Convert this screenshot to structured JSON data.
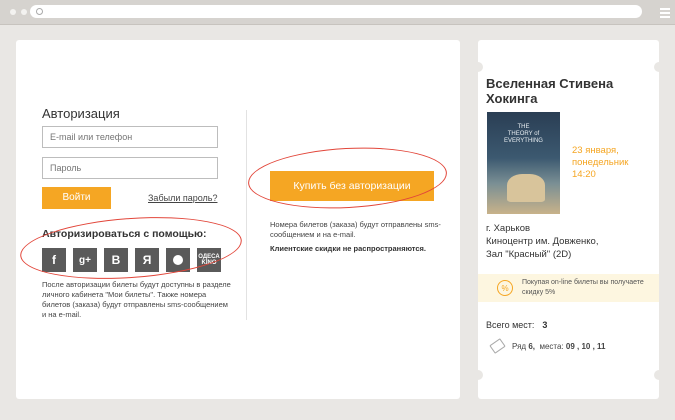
{
  "browser": {
    "icon": "search-icon"
  },
  "auth": {
    "title": "Авторизация",
    "email_placeholder": "E-mail или телефон",
    "password_placeholder": "Пароль",
    "login_label": "Войти",
    "forgot_label": "Забыли пароль?",
    "social_title": "Авторизироваться с помощью:",
    "social": {
      "facebook": "f",
      "gplus": "g+",
      "vk": "B",
      "yandex": "Я",
      "kino_line1": "ОДЕСА",
      "kino_line2": "KINO"
    },
    "after_note": "После авторизации билеты будут доступны в разделе личного кабинета \"Мои билеты\". Также номера билетов (заказа) будут отправлены sms-сообщением и на e-mail."
  },
  "buy": {
    "label": "Купить без авторизации",
    "note": "Номера билетов (заказа) будут отправлены sms-сообщением и на e-mail.",
    "discount_note": "Клиентские скидки не распространяются."
  },
  "film": {
    "title": "Вселенная Стивена Хокинга",
    "poster_line1": "THE",
    "poster_line2": "THEORY of",
    "poster_line3": "EVERYTHING",
    "date_line1": "23 января,",
    "date_line2": "понедельник",
    "time": "14:20",
    "city": "г. Харьков",
    "cinema": "Киноцентр им. Довженко,",
    "hall": "Зал \"Красный\" (2D)",
    "promo_icon": "%",
    "promo_text": "Покупая on-line билеты вы получаете скидку 5%",
    "total_label": "Всего мест:",
    "total_value": "3",
    "row_label": "Ряд",
    "row_value": "6,",
    "seats_label": "места:",
    "seats_value": "09 , 10 , 11"
  },
  "colors": {
    "accent": "#f5a623",
    "annotation": "#e2463a"
  }
}
